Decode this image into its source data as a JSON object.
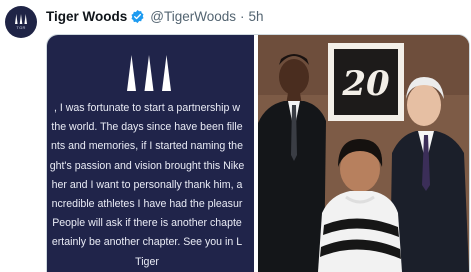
{
  "tweet": {
    "author_name": "Tiger Woods",
    "verified": true,
    "handle": "@TigerWoods",
    "separator": "·",
    "timestamp": "5h",
    "avatar_text": "TGR"
  },
  "media": {
    "left_image": {
      "statement_lines": [
        ", I was fortunate to start a partnership w",
        "the world. The days since have been fille",
        "nts and memories, if I started naming the",
        "ght's passion and vision brought this Nike",
        "her and I want to personally thank him, a",
        "ncredible athletes I have had the pleasur",
        "People will ask if there is another chapte",
        "ertainly be another chapter. See you in L",
        "Tiger"
      ]
    },
    "right_image": {
      "backdrop_text": "20"
    }
  },
  "colors": {
    "verified_blue": "#1d9bf0",
    "statement_bg": "#20244a",
    "secondary_text": "#536471"
  }
}
